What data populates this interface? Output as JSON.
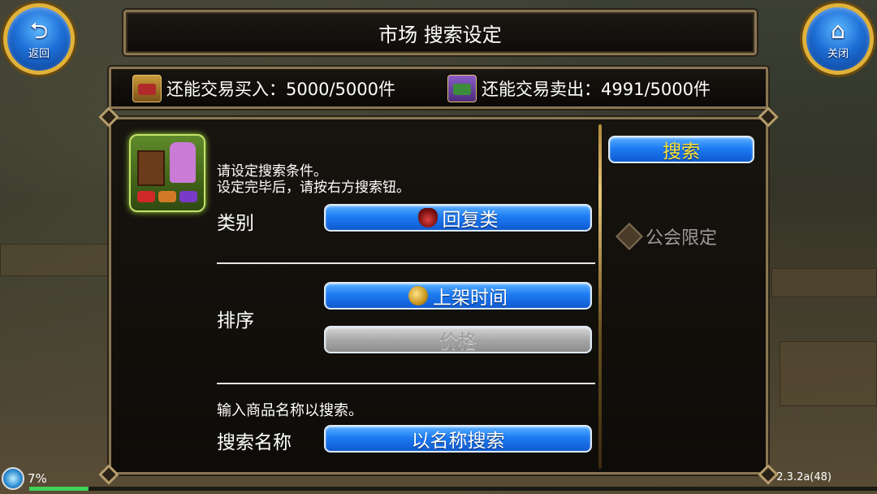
{
  "corner_buttons": {
    "back_label": "返回",
    "close_label": "关闭"
  },
  "title": "市场 搜索设定",
  "limits": {
    "buy": "还能交易买入：5000/5000件",
    "sell": "还能交易卖出：4991/5000件"
  },
  "panel": {
    "instruction_line1": "请设定搜索条件。",
    "instruction_line2": "设定完毕后，请按右方搜索钮。",
    "category_label": "类别",
    "category_value": "回复类",
    "sort_label": "排序",
    "sort_time": "上架时间",
    "sort_price": "价格",
    "name_hint": "输入商品名称以搜索。",
    "name_label": "搜索名称",
    "name_button": "以名称搜索",
    "search_button": "搜索",
    "guild_limit": "公会限定"
  },
  "status": {
    "progress_text": "7%",
    "progress_fraction": 0.07,
    "version": "2.3.2a(48)"
  },
  "colors": {
    "accent_blue": "#1d7bf2",
    "search_text": "#ffe437",
    "frame_gold": "#8a7654",
    "progress_green": "#3fd15a"
  },
  "icons": {
    "back": "return-arrow-icon",
    "close": "home-icon",
    "category": "potion-icon",
    "sort_time": "coin-icon",
    "guild": "diamond-icon"
  }
}
